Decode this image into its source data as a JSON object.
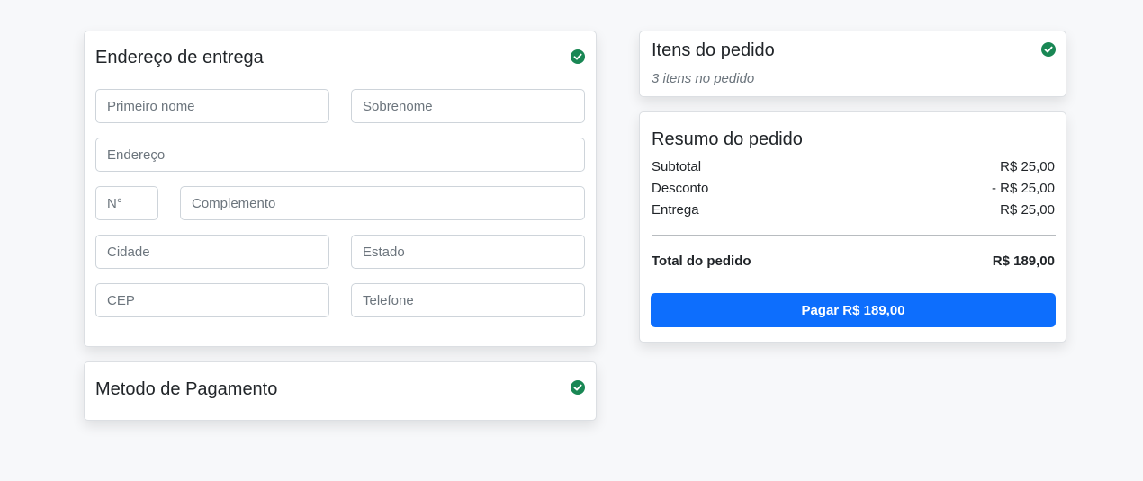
{
  "colors": {
    "background": "#f7f8fa",
    "success": "#198754",
    "primary": "#0d6efd"
  },
  "shipping": {
    "title": "Endereço de entrega",
    "status_icon": "check-circle-icon",
    "fields": {
      "first_name": {
        "placeholder": "Primeiro nome",
        "value": ""
      },
      "last_name": {
        "placeholder": "Sobrenome",
        "value": ""
      },
      "address": {
        "placeholder": "Endereço",
        "value": ""
      },
      "number": {
        "placeholder": "N°",
        "value": ""
      },
      "complement": {
        "placeholder": "Complemento",
        "value": ""
      },
      "city": {
        "placeholder": "Cidade",
        "value": ""
      },
      "state": {
        "placeholder": "Estado",
        "value": ""
      },
      "zip": {
        "placeholder": "CEP",
        "value": ""
      },
      "phone": {
        "placeholder": "Telefone",
        "value": ""
      }
    }
  },
  "payment": {
    "title": "Metodo de Pagamento",
    "status_icon": "check-circle-icon"
  },
  "items": {
    "title": "Itens do pedido",
    "subtitle": "3 itens no pedido",
    "status_icon": "check-circle-icon"
  },
  "summary": {
    "title": "Resumo do pedido",
    "rows": [
      {
        "label": "Subtotal",
        "value": "R$ 25,00"
      },
      {
        "label": "Desconto",
        "value": "- R$ 25,00"
      },
      {
        "label": "Entrega",
        "value": "R$ 25,00"
      }
    ],
    "total_label": "Total do pedido",
    "total_value": "R$ 189,00",
    "pay_button": "Pagar R$ 189,00"
  }
}
